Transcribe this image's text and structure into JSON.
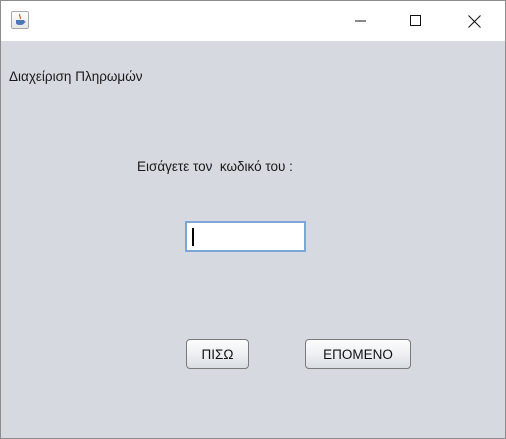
{
  "window": {
    "icons": {
      "app": "java-cup-icon",
      "minimize": "minimize-icon",
      "maximize": "maximize-icon",
      "close": "close-icon"
    }
  },
  "main": {
    "heading": "Διαχείριση Πληρωμών",
    "code_prompt": "Εισάγετε τον  κωδικό του :",
    "code_input_value": "",
    "back_label": "ΠΙΣΩ",
    "next_label": "ΕΠΟΜΕΝΟ"
  },
  "colors": {
    "panel_background": "#d6d9df",
    "input_focus_border": "#7aa7d6"
  }
}
